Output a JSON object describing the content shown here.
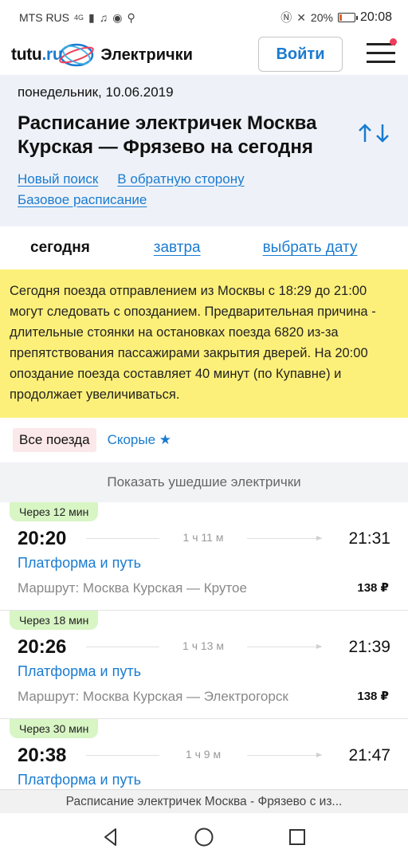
{
  "status_bar": {
    "carrier": "MTS RUS",
    "network": "4G",
    "battery_text": "20%",
    "battery_level": 0.2,
    "time": "20:08"
  },
  "header": {
    "logo_main": "tutu",
    "logo_domain": ".ru",
    "app_name": "Электрички",
    "login_label": "Войти"
  },
  "route": {
    "date": "понедельник, 10.06.2019",
    "title": "Расписание электричек Москва Курская — Фрязево на сегодня",
    "links": [
      "Новый поиск",
      "В обратную сторону",
      "Базовое расписание"
    ]
  },
  "day_tabs": {
    "today": "сегодня",
    "tomorrow": "завтра",
    "pick_date": "выбрать дату"
  },
  "notice": "Сегодня поезда отправлением из Москвы с 18:29 до 21:00 могут следовать с опозданием. Предварительная причина - длительные стоянки на остановках поезда 6820 из-за препятствования пассажирами закрытия дверей. На 20:00 опоздание поезда составляет 40 минут (по Купавне) и продолжает увеличиваться.",
  "filters": {
    "all": "Все поезда",
    "fast": "Скорые ★"
  },
  "show_past": "Показать ушедшие электрички",
  "trains": [
    {
      "badge": "Через 12 мин",
      "dep": "20:20",
      "duration": "1 ч 11 м",
      "arr": "21:31",
      "platform": "Платформа и путь",
      "route": "Маршрут: Москва Курская — Крутое",
      "price": "138 ₽"
    },
    {
      "badge": "Через 18 мин",
      "dep": "20:26",
      "duration": "1 ч 13 м",
      "arr": "21:39",
      "platform": "Платформа и путь",
      "route": "Маршрут: Москва Курская — Электрогорск",
      "price": "138 ₽"
    },
    {
      "badge": "Через 30 мин",
      "dep": "20:38",
      "duration": "1 ч 9 м",
      "arr": "21:47",
      "platform": "Платформа и путь"
    }
  ],
  "page_strip": "Расписание электричек Москва - Фрязево с из..."
}
